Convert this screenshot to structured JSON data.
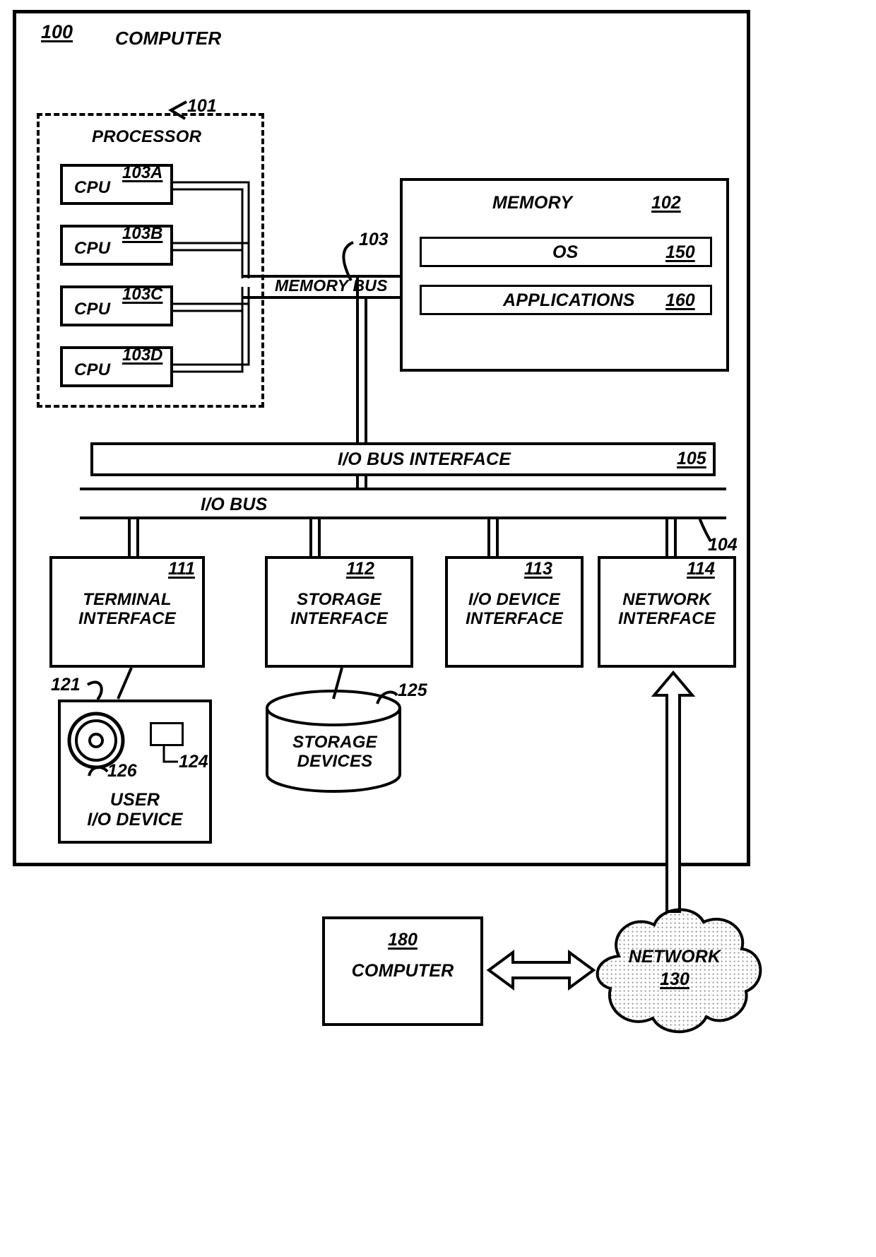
{
  "figure": {
    "root_ref": "100",
    "root_label": "COMPUTER",
    "processor": {
      "ref": "101",
      "label": "PROCESSOR",
      "cpus": [
        {
          "label": "CPU",
          "ref": "103A"
        },
        {
          "label": "CPU",
          "ref": "103B"
        },
        {
          "label": "CPU",
          "ref": "103C"
        },
        {
          "label": "CPU",
          "ref": "103D"
        }
      ]
    },
    "memory": {
      "ref": "102",
      "label": "MEMORY",
      "items": [
        {
          "label": "OS",
          "ref": "150"
        },
        {
          "label": "APPLICATIONS",
          "ref": "160"
        }
      ]
    },
    "memory_bus": {
      "label": "MEMORY BUS",
      "ref": "103"
    },
    "io_bus_interface": {
      "label": "I/O BUS INTERFACE",
      "ref": "105"
    },
    "io_bus": {
      "label": "I/O BUS",
      "ref": "104"
    },
    "interfaces": [
      {
        "ref": "111",
        "line1": "TERMINAL",
        "line2": "INTERFACE"
      },
      {
        "ref": "112",
        "line1": "STORAGE",
        "line2": "INTERFACE"
      },
      {
        "ref": "113",
        "line1": "I/O DEVICE",
        "line2": "INTERFACE"
      },
      {
        "ref": "114",
        "line1": "NETWORK",
        "line2": "INTERFACE"
      }
    ],
    "user_io_device": {
      "ref": "121",
      "line1": "USER",
      "line2": "I/O DEVICE",
      "dial_ref": "126",
      "key_ref": "124"
    },
    "storage_devices": {
      "ref": "125",
      "line1": "STORAGE",
      "line2": "DEVICES"
    },
    "network": {
      "ref": "130",
      "label": "NETWORK"
    },
    "remote_computer": {
      "ref": "180",
      "label": "COMPUTER"
    }
  }
}
